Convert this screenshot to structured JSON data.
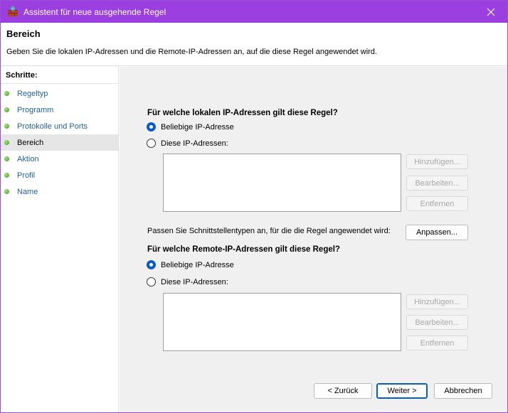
{
  "window": {
    "title": "Assistent für neue ausgehende Regel",
    "accent": "#9b3fe0"
  },
  "header": {
    "title": "Bereich",
    "description": "Geben Sie die lokalen IP-Adressen und die Remote-IP-Adressen an, auf die diese Regel angewendet wird."
  },
  "sidebar": {
    "heading": "Schritte:",
    "steps": [
      {
        "label": "Regeltyp",
        "active": false
      },
      {
        "label": "Programm",
        "active": false
      },
      {
        "label": "Protokolle und Ports",
        "active": false
      },
      {
        "label": "Bereich",
        "active": true
      },
      {
        "label": "Aktion",
        "active": false
      },
      {
        "label": "Profil",
        "active": false
      },
      {
        "label": "Name",
        "active": false
      }
    ]
  },
  "local": {
    "question": "Für welche lokalen IP-Adressen gilt diese Regel?",
    "option_any": "Beliebige IP-Adresse",
    "option_these": "Diese IP-Adressen:",
    "selected": "any",
    "add": "Hinzufügen...",
    "edit": "Bearbeiten...",
    "remove": "Entfernen"
  },
  "interface": {
    "text": "Passen Sie Schnittstellentypen an, für die die Regel angewendet wird:",
    "button": "Anpassen..."
  },
  "remote": {
    "question": "Für welche Remote-IP-Adressen gilt diese Regel?",
    "option_any": "Beliebige IP-Adresse",
    "option_these": "Diese IP-Adressen:",
    "selected": "any",
    "add": "Hinzufügen...",
    "edit": "Bearbeiten...",
    "remove": "Entfernen"
  },
  "footer": {
    "back": "< Zurück",
    "next": "Weiter >",
    "cancel": "Abbrechen"
  }
}
